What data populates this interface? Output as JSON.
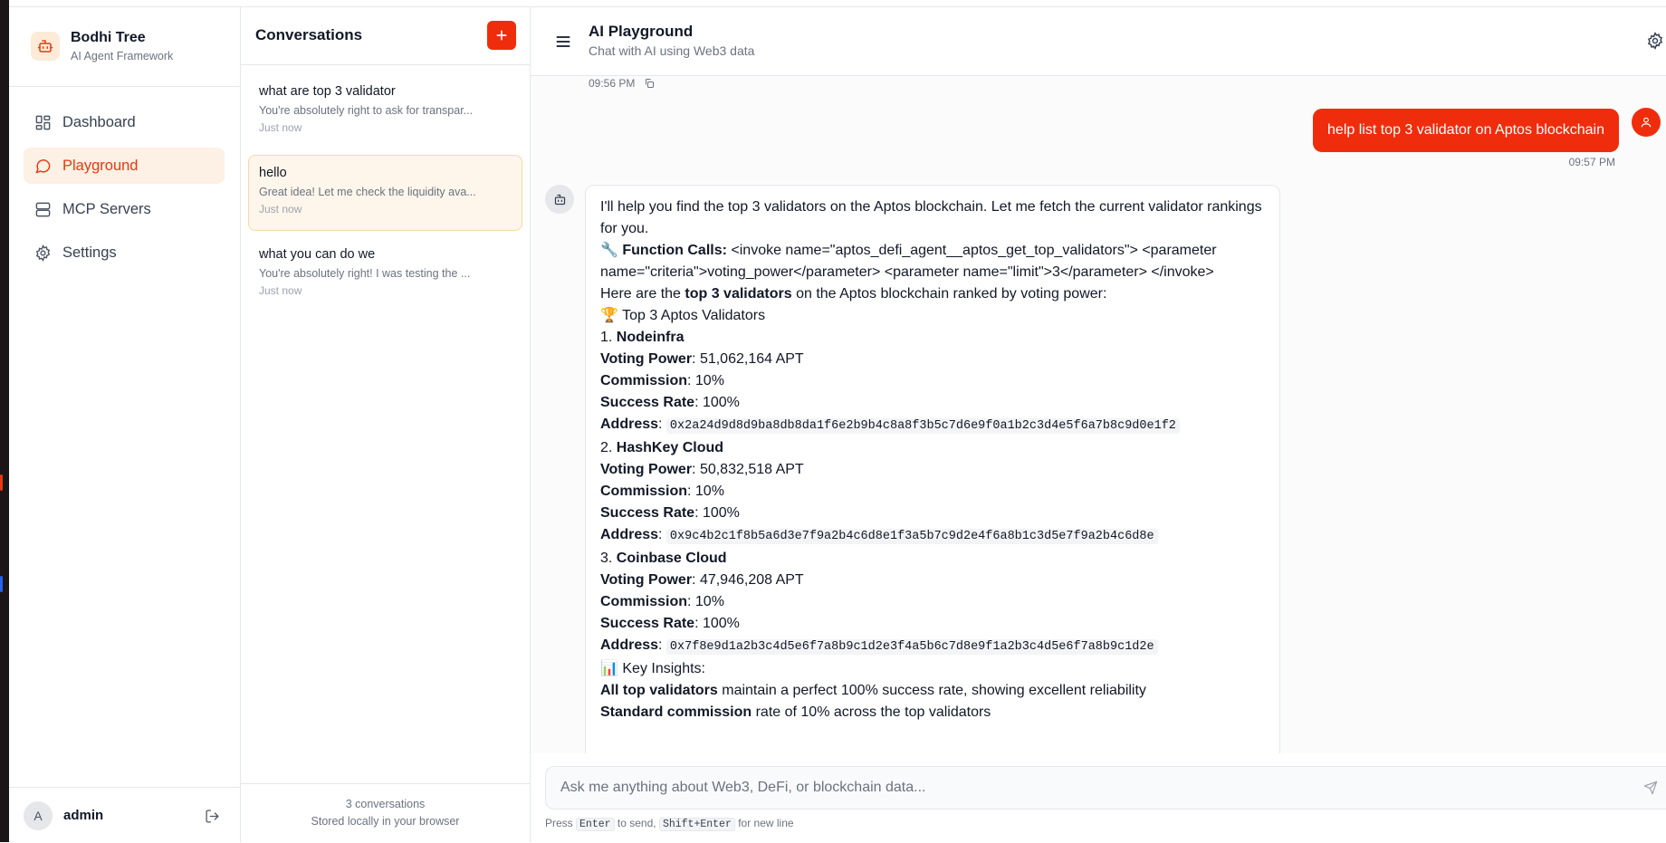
{
  "sidebar": {
    "brand_name": "Bodhi Tree",
    "brand_subtitle": "AI Agent Framework",
    "items": [
      {
        "label": "Dashboard",
        "icon": "dashboard-icon",
        "active": false
      },
      {
        "label": "Playground",
        "icon": "chat-bubble-icon",
        "active": true
      },
      {
        "label": "MCP Servers",
        "icon": "server-icon",
        "active": false
      },
      {
        "label": "Settings",
        "icon": "gear-icon",
        "active": false
      }
    ],
    "user": {
      "avatar_initial": "A",
      "name": "admin"
    }
  },
  "conversations": {
    "title": "Conversations",
    "items": [
      {
        "title": "what are top 3 validator",
        "preview": "You're absolutely right to ask for transpar...",
        "time": "Just now",
        "active": false
      },
      {
        "title": "hello",
        "preview": "Great idea! Let me check the liquidity ava...",
        "time": "Just now",
        "active": true
      },
      {
        "title": "what you can do we",
        "preview": "You're absolutely right! I was testing the ...",
        "time": "Just now",
        "active": false
      }
    ],
    "footer_count": "3 conversations",
    "footer_note": "Stored locally in your browser"
  },
  "main": {
    "title": "AI Playground",
    "subtitle": "Chat with AI using Web3 data"
  },
  "chat": {
    "previous_time": "09:56 PM",
    "user_message": "help list top 3 validator on Aptos blockchain",
    "user_time": "09:57 PM",
    "assistant": {
      "intro": "I'll help you find the top 3 validators on the Aptos blockchain. Let me fetch the current validator rankings for you.",
      "function_calls_label": "Function Calls:",
      "function_calls_text": "<invoke name=\"aptos_defi_agent__aptos_get_top_validators\"> <parameter name=\"criteria\">voting_power</parameter> <parameter name=\"limit\">3</parameter> </invoke>",
      "summary_pre": "Here are the ",
      "summary_bold": "top 3 validators",
      "summary_post": " on the Aptos blockchain ranked by voting power:",
      "top_heading": "Top 3 Aptos Validators",
      "field_labels": {
        "voting_power": "Voting Power",
        "commission": "Commission",
        "success_rate": "Success Rate",
        "address": "Address"
      },
      "validators": [
        {
          "rank": "1.",
          "name": "Nodeinfra",
          "voting_power": "51,062,164 APT",
          "commission": "10%",
          "success_rate": "100%",
          "address": "0x2a24d9d8d9ba8db8da1f6e2b9b4c8a8f3b5c7d6e9f0a1b2c3d4e5f6a7b8c9d0e1f2"
        },
        {
          "rank": "2.",
          "name": "HashKey Cloud",
          "voting_power": "50,832,518 APT",
          "commission": "10%",
          "success_rate": "100%",
          "address": "0x9c4b2c1f8b5a6d3e7f9a2b4c6d8e1f3a5b7c9d2e4f6a8b1c3d5e7f9a2b4c6d8e"
        },
        {
          "rank": "3.",
          "name": "Coinbase Cloud",
          "voting_power": "47,946,208 APT",
          "commission": "10%",
          "success_rate": "100%",
          "address": "0x7f8e9d1a2b3c4d5e6f7a8b9c1d2e3f4a5b6c7d8e9f1a2b3c4d5e6f7a8b9c1d2e"
        }
      ],
      "insights_heading": "Key Insights:",
      "insights": [
        {
          "bold": "All top validators",
          "text": " maintain a perfect 100% success rate, showing excellent reliability"
        },
        {
          "bold": "Standard commission",
          "text": " rate of 10% across the top validators"
        }
      ]
    }
  },
  "composer": {
    "placeholder": "Ask me anything about Web3, DeFi, or blockchain data...",
    "hint_press": "Press",
    "hint_enter": "Enter",
    "hint_to_send": "to send,",
    "hint_shift_enter": "Shift+Enter",
    "hint_new_line": "for new line"
  },
  "colors": {
    "accent": "#ef2d0c",
    "active_bg": "#fdf0e4",
    "active_conv_bg": "#fef6ea",
    "active_conv_border": "#f7d9a8"
  }
}
